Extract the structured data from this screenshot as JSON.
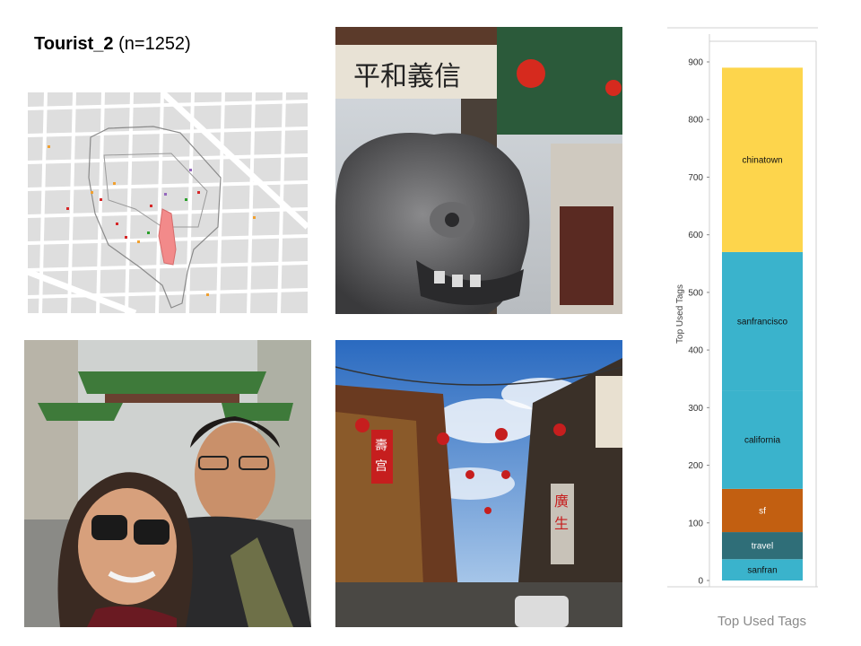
{
  "slide": {
    "title_bold": "Tourist_2",
    "title_rest": " (n=1252)",
    "caption": "Top Used Tags"
  },
  "images": {
    "map": "street-map-with-route",
    "photo_gate": "chinatown-gate-lion-statue",
    "photo_selfie": "couple-selfie-at-dragon-gate",
    "photo_street": "chinatown-street-with-lanterns"
  },
  "colors": {
    "chinatown": "#fdd54c",
    "sanfrancisco": "#3ab3cc",
    "california": "#3ab3cc",
    "sf": "#c25f11",
    "travel": "#2f6e78",
    "sanfran": "#3ab3cc"
  },
  "chart_data": {
    "type": "bar",
    "stacked": true,
    "ylabel": "Top Used Tags",
    "ylim": [
      0,
      940
    ],
    "yticks": [
      0,
      100,
      200,
      300,
      400,
      500,
      600,
      700,
      800,
      900
    ],
    "series": [
      {
        "name": "sanfran",
        "value": 37,
        "start": 0
      },
      {
        "name": "travel",
        "value": 47,
        "start": 37
      },
      {
        "name": "sf",
        "value": 75,
        "start": 84
      },
      {
        "name": "california",
        "value": 171,
        "start": 159
      },
      {
        "name": "sanfrancisco",
        "value": 240,
        "start": 330
      },
      {
        "name": "chinatown",
        "value": 320,
        "start": 570
      }
    ],
    "total": 890
  }
}
